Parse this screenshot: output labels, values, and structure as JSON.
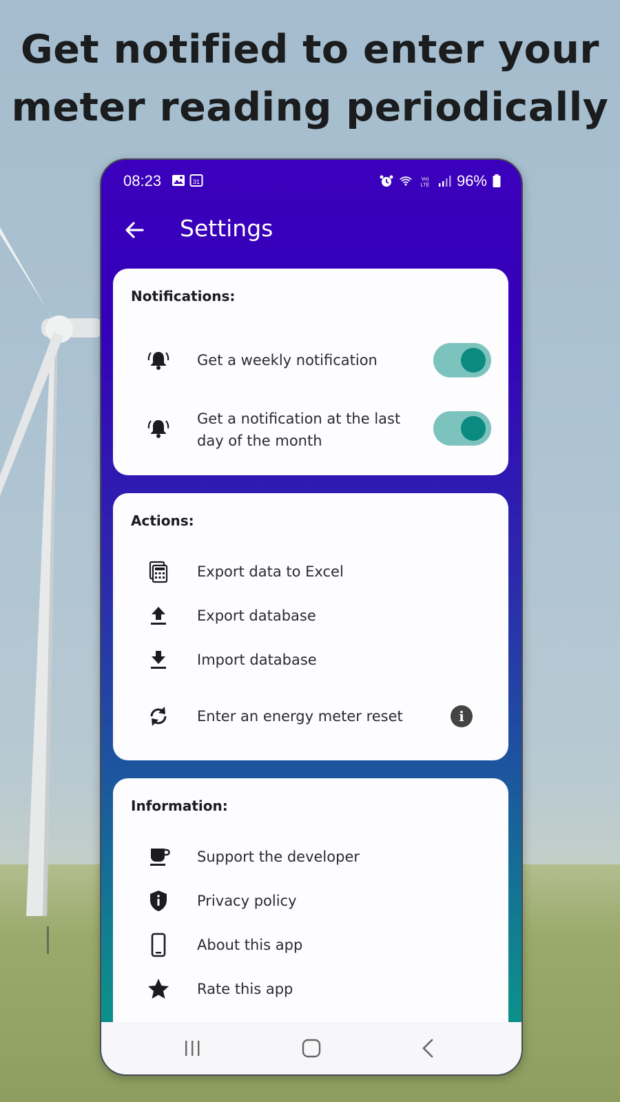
{
  "headline": {
    "line1": "Get notified to enter your",
    "line2": "meter reading periodically"
  },
  "statusbar": {
    "time": "08:23",
    "battery": "96%",
    "left_icons": [
      "image-icon",
      "calendar-icon"
    ],
    "right_icons": [
      "alarm-icon",
      "wifi-icon",
      "volte-icon",
      "signal-icon",
      "battery-icon"
    ]
  },
  "appbar": {
    "title": "Settings",
    "back_icon": "arrow-back-icon"
  },
  "notifications": {
    "title": "Notifications:",
    "items": [
      {
        "label": "Get a weekly notification",
        "icon": "bell-ring-icon",
        "enabled": true
      },
      {
        "label_line1": "Get a notification at the last",
        "label_line2": "day of the month",
        "icon": "bell-ring-icon",
        "enabled": true
      }
    ]
  },
  "actions": {
    "title": "Actions:",
    "items": [
      {
        "label": "Export data to Excel",
        "icon": "calculator-icon"
      },
      {
        "label": "Export database",
        "icon": "upload-icon"
      },
      {
        "label": "Import database",
        "icon": "download-icon"
      },
      {
        "label": "Enter an energy meter reset",
        "icon": "refresh-icon",
        "info_icon": "info-icon"
      }
    ]
  },
  "information": {
    "title": "Information:",
    "items": [
      {
        "label": "Support the developer",
        "icon": "coffee-icon"
      },
      {
        "label": "Privacy policy",
        "icon": "shield-icon"
      },
      {
        "label": "About this app",
        "icon": "phone-icon"
      },
      {
        "label": "Rate this app",
        "icon": "star-icon"
      }
    ]
  },
  "navbar": {
    "icons": [
      "recents-icon",
      "home-icon",
      "back-icon"
    ]
  },
  "colors": {
    "appbar_top": "#3b00bb",
    "gradient_bottom": "#0a9889",
    "switch_track": "#7cc3bd",
    "switch_knob": "#0a8a80",
    "card_bg": "#fdfcff"
  }
}
